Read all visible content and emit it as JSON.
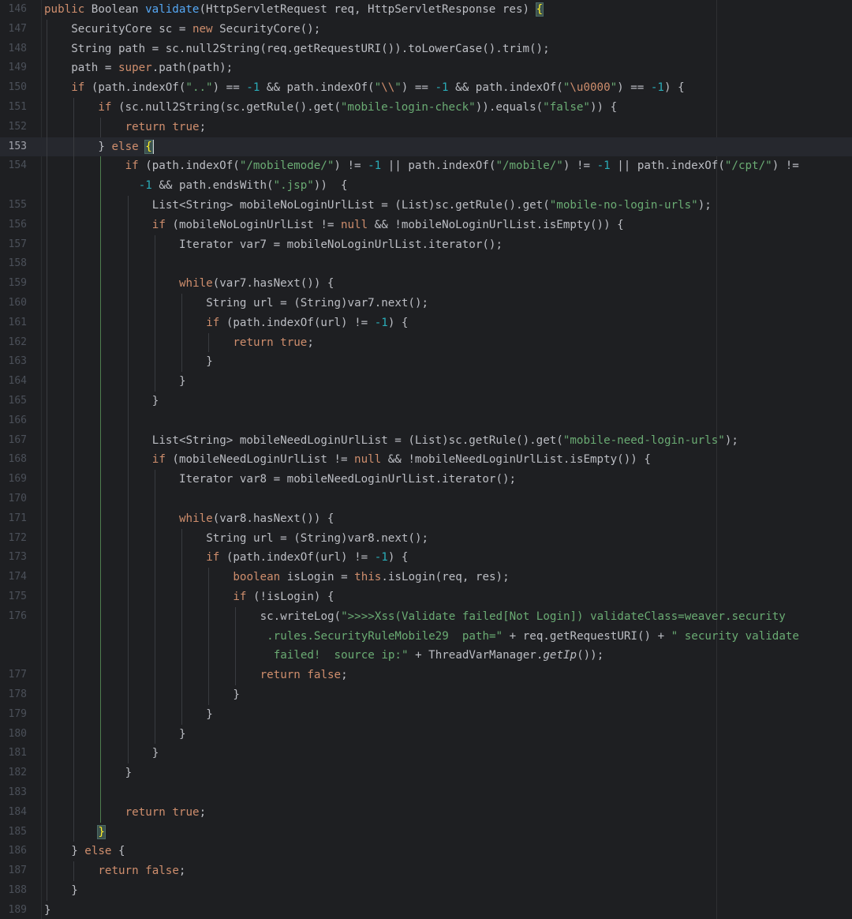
{
  "editor": {
    "current_line": 153,
    "lines": [
      {
        "n": "146",
        "indent": 1,
        "t": [
          [
            "kw",
            "public "
          ],
          [
            "",
            "Boolean "
          ],
          [
            "fn",
            "validate"
          ],
          [
            "",
            "(HttpServletRequest req, HttpServletResponse res) "
          ],
          [
            "hl",
            "{"
          ]
        ]
      },
      {
        "n": "147",
        "indent": 2,
        "t": [
          [
            "",
            "SecurityCore sc = "
          ],
          [
            "kw",
            "new "
          ],
          [
            "",
            "SecurityCore();"
          ]
        ]
      },
      {
        "n": "148",
        "indent": 2,
        "t": [
          [
            "",
            "String path = sc.null2String(req.getRequestURI()).toLowerCase().trim();"
          ]
        ]
      },
      {
        "n": "149",
        "indent": 2,
        "t": [
          [
            "",
            "path = "
          ],
          [
            "kw",
            "super"
          ],
          [
            "",
            ".path(path);"
          ]
        ]
      },
      {
        "n": "150",
        "indent": 2,
        "t": [
          [
            "kw",
            "if "
          ],
          [
            "",
            "(path.indexOf("
          ],
          [
            "str",
            "\"..\""
          ],
          [
            "",
            ") == "
          ],
          [
            "num",
            "-1"
          ],
          [
            "",
            " && path.indexOf("
          ],
          [
            "str",
            "\""
          ],
          [
            "esc",
            "\\\\"
          ],
          [
            "str",
            "\""
          ],
          [
            "",
            ") == "
          ],
          [
            "num",
            "-1"
          ],
          [
            "",
            " && path.indexOf("
          ],
          [
            "str",
            "\""
          ],
          [
            "esc",
            "\\u0000"
          ],
          [
            "str",
            "\""
          ],
          [
            "",
            ") == "
          ],
          [
            "num",
            "-1"
          ],
          [
            "",
            ") {"
          ]
        ]
      },
      {
        "n": "151",
        "indent": 3,
        "t": [
          [
            "kw",
            "if "
          ],
          [
            "",
            "(sc.null2String(sc.getRule().get("
          ],
          [
            "str",
            "\"mobile-login-check\""
          ],
          [
            "",
            ")).equals("
          ],
          [
            "str",
            "\"false\""
          ],
          [
            "",
            ")) {"
          ]
        ]
      },
      {
        "n": "152",
        "indent": 4,
        "t": [
          [
            "kw",
            "return true"
          ],
          [
            "",
            ";"
          ]
        ]
      },
      {
        "n": "153",
        "indent": 3,
        "t": [
          [
            "",
            "} "
          ],
          [
            "kw",
            "else "
          ],
          [
            "hl",
            "{"
          ],
          [
            "cursor",
            ""
          ]
        ]
      },
      {
        "n": "154",
        "indent": 4,
        "t": [
          [
            "kw",
            "if "
          ],
          [
            "",
            "(path.indexOf("
          ],
          [
            "str",
            "\"/mobilemode/\""
          ],
          [
            "",
            ") != "
          ],
          [
            "num",
            "-1"
          ],
          [
            "",
            " || path.indexOf("
          ],
          [
            "str",
            "\"/mobile/\""
          ],
          [
            "",
            ") != "
          ],
          [
            "num",
            "-1"
          ],
          [
            "",
            " || path.indexOf("
          ],
          [
            "str",
            "\"/cpt/\""
          ],
          [
            "",
            ") !="
          ]
        ]
      },
      {
        "n": "",
        "indent": 4,
        "wrap": 0.5,
        "t": [
          [
            "num",
            "-1"
          ],
          [
            "",
            " && path.endsWith("
          ],
          [
            "str",
            "\".jsp\""
          ],
          [
            "",
            "))  {"
          ]
        ]
      },
      {
        "n": "155",
        "indent": 5,
        "t": [
          [
            "",
            "List<String> mobileNoLoginUrlList = (List)sc.getRule().get("
          ],
          [
            "str",
            "\"mobile-no-login-urls\""
          ],
          [
            "",
            ");"
          ]
        ]
      },
      {
        "n": "156",
        "indent": 5,
        "t": [
          [
            "kw",
            "if "
          ],
          [
            "",
            "(mobileNoLoginUrlList != "
          ],
          [
            "kw",
            "null"
          ],
          [
            "",
            " && !mobileNoLoginUrlList.isEmpty()) {"
          ]
        ]
      },
      {
        "n": "157",
        "indent": 6,
        "t": [
          [
            "",
            "Iterator var7 = mobileNoLoginUrlList.iterator();"
          ]
        ]
      },
      {
        "n": "158",
        "indent": 6,
        "t": []
      },
      {
        "n": "159",
        "indent": 6,
        "t": [
          [
            "kw",
            "while"
          ],
          [
            "",
            "(var7.hasNext()) {"
          ]
        ]
      },
      {
        "n": "160",
        "indent": 7,
        "t": [
          [
            "",
            "String url = (String)var7.next();"
          ]
        ]
      },
      {
        "n": "161",
        "indent": 7,
        "t": [
          [
            "kw",
            "if "
          ],
          [
            "",
            "(path.indexOf(url) != "
          ],
          [
            "num",
            "-1"
          ],
          [
            "",
            ") {"
          ]
        ]
      },
      {
        "n": "162",
        "indent": 8,
        "t": [
          [
            "kw",
            "return true"
          ],
          [
            "",
            ";"
          ]
        ]
      },
      {
        "n": "163",
        "indent": 7,
        "t": [
          [
            "",
            "}"
          ]
        ]
      },
      {
        "n": "164",
        "indent": 6,
        "t": [
          [
            "",
            "}"
          ]
        ]
      },
      {
        "n": "165",
        "indent": 5,
        "t": [
          [
            "",
            "}"
          ]
        ]
      },
      {
        "n": "166",
        "indent": 5,
        "t": []
      },
      {
        "n": "167",
        "indent": 5,
        "t": [
          [
            "",
            "List<String> mobileNeedLoginUrlList = (List)sc.getRule().get("
          ],
          [
            "str",
            "\"mobile-need-login-urls\""
          ],
          [
            "",
            ");"
          ]
        ]
      },
      {
        "n": "168",
        "indent": 5,
        "t": [
          [
            "kw",
            "if "
          ],
          [
            "",
            "(mobileNeedLoginUrlList != "
          ],
          [
            "kw",
            "null"
          ],
          [
            "",
            " && !mobileNeedLoginUrlList.isEmpty()) {"
          ]
        ]
      },
      {
        "n": "169",
        "indent": 6,
        "t": [
          [
            "",
            "Iterator var8 = mobileNeedLoginUrlList.iterator();"
          ]
        ]
      },
      {
        "n": "170",
        "indent": 6,
        "t": []
      },
      {
        "n": "171",
        "indent": 6,
        "t": [
          [
            "kw",
            "while"
          ],
          [
            "",
            "(var8.hasNext()) {"
          ]
        ]
      },
      {
        "n": "172",
        "indent": 7,
        "t": [
          [
            "",
            "String url = (String)var8.next();"
          ]
        ]
      },
      {
        "n": "173",
        "indent": 7,
        "t": [
          [
            "kw",
            "if "
          ],
          [
            "",
            "(path.indexOf(url) != "
          ],
          [
            "num",
            "-1"
          ],
          [
            "",
            ") {"
          ]
        ]
      },
      {
        "n": "174",
        "indent": 8,
        "t": [
          [
            "kw",
            "boolean "
          ],
          [
            "",
            "isLogin = "
          ],
          [
            "kw",
            "this"
          ],
          [
            "",
            ".isLogin(req, res);"
          ]
        ]
      },
      {
        "n": "175",
        "indent": 8,
        "t": [
          [
            "kw",
            "if "
          ],
          [
            "",
            "(!isLogin) {"
          ]
        ]
      },
      {
        "n": "176",
        "indent": 9,
        "t": [
          [
            "",
            "sc.writeLog("
          ],
          [
            "str",
            "\">>>>Xss(Validate failed[Not Login]) validateClass=weaver.security"
          ]
        ]
      },
      {
        "n": "",
        "indent": 9,
        "wrap": 0.25,
        "t": [
          [
            "str",
            ".rules.SecurityRuleMobile29  path=\""
          ],
          [
            "",
            " + req.getRequestURI() + "
          ],
          [
            "str",
            "\" security validate"
          ]
        ]
      },
      {
        "n": "",
        "indent": 9,
        "wrap": 0.5,
        "t": [
          [
            "str",
            "failed!  source ip:\""
          ],
          [
            "",
            " + ThreadVarManager."
          ],
          [
            "it",
            "getIp"
          ],
          [
            "",
            "());"
          ]
        ]
      },
      {
        "n": "177",
        "indent": 9,
        "t": [
          [
            "kw",
            "return false"
          ],
          [
            "",
            ";"
          ]
        ]
      },
      {
        "n": "178",
        "indent": 8,
        "t": [
          [
            "",
            "}"
          ]
        ]
      },
      {
        "n": "179",
        "indent": 7,
        "t": [
          [
            "",
            "}"
          ]
        ]
      },
      {
        "n": "180",
        "indent": 6,
        "t": [
          [
            "",
            "}"
          ]
        ]
      },
      {
        "n": "181",
        "indent": 5,
        "t": [
          [
            "",
            "}"
          ]
        ]
      },
      {
        "n": "182",
        "indent": 4,
        "t": [
          [
            "",
            "}"
          ]
        ]
      },
      {
        "n": "183",
        "indent": 4,
        "t": []
      },
      {
        "n": "184",
        "indent": 4,
        "t": [
          [
            "kw",
            "return true"
          ],
          [
            "",
            ";"
          ]
        ]
      },
      {
        "n": "185",
        "indent": 3,
        "t": [
          [
            "hl",
            "}"
          ]
        ]
      },
      {
        "n": "186",
        "indent": 2,
        "t": [
          [
            "",
            "} "
          ],
          [
            "kw",
            "else "
          ],
          [
            "",
            "{"
          ]
        ]
      },
      {
        "n": "187",
        "indent": 3,
        "t": [
          [
            "kw",
            "return false"
          ],
          [
            "",
            ";"
          ]
        ]
      },
      {
        "n": "188",
        "indent": 2,
        "t": [
          [
            "",
            "}"
          ]
        ]
      },
      {
        "n": "189",
        "indent": 1,
        "t": [
          [
            "",
            "}"
          ]
        ]
      }
    ]
  }
}
